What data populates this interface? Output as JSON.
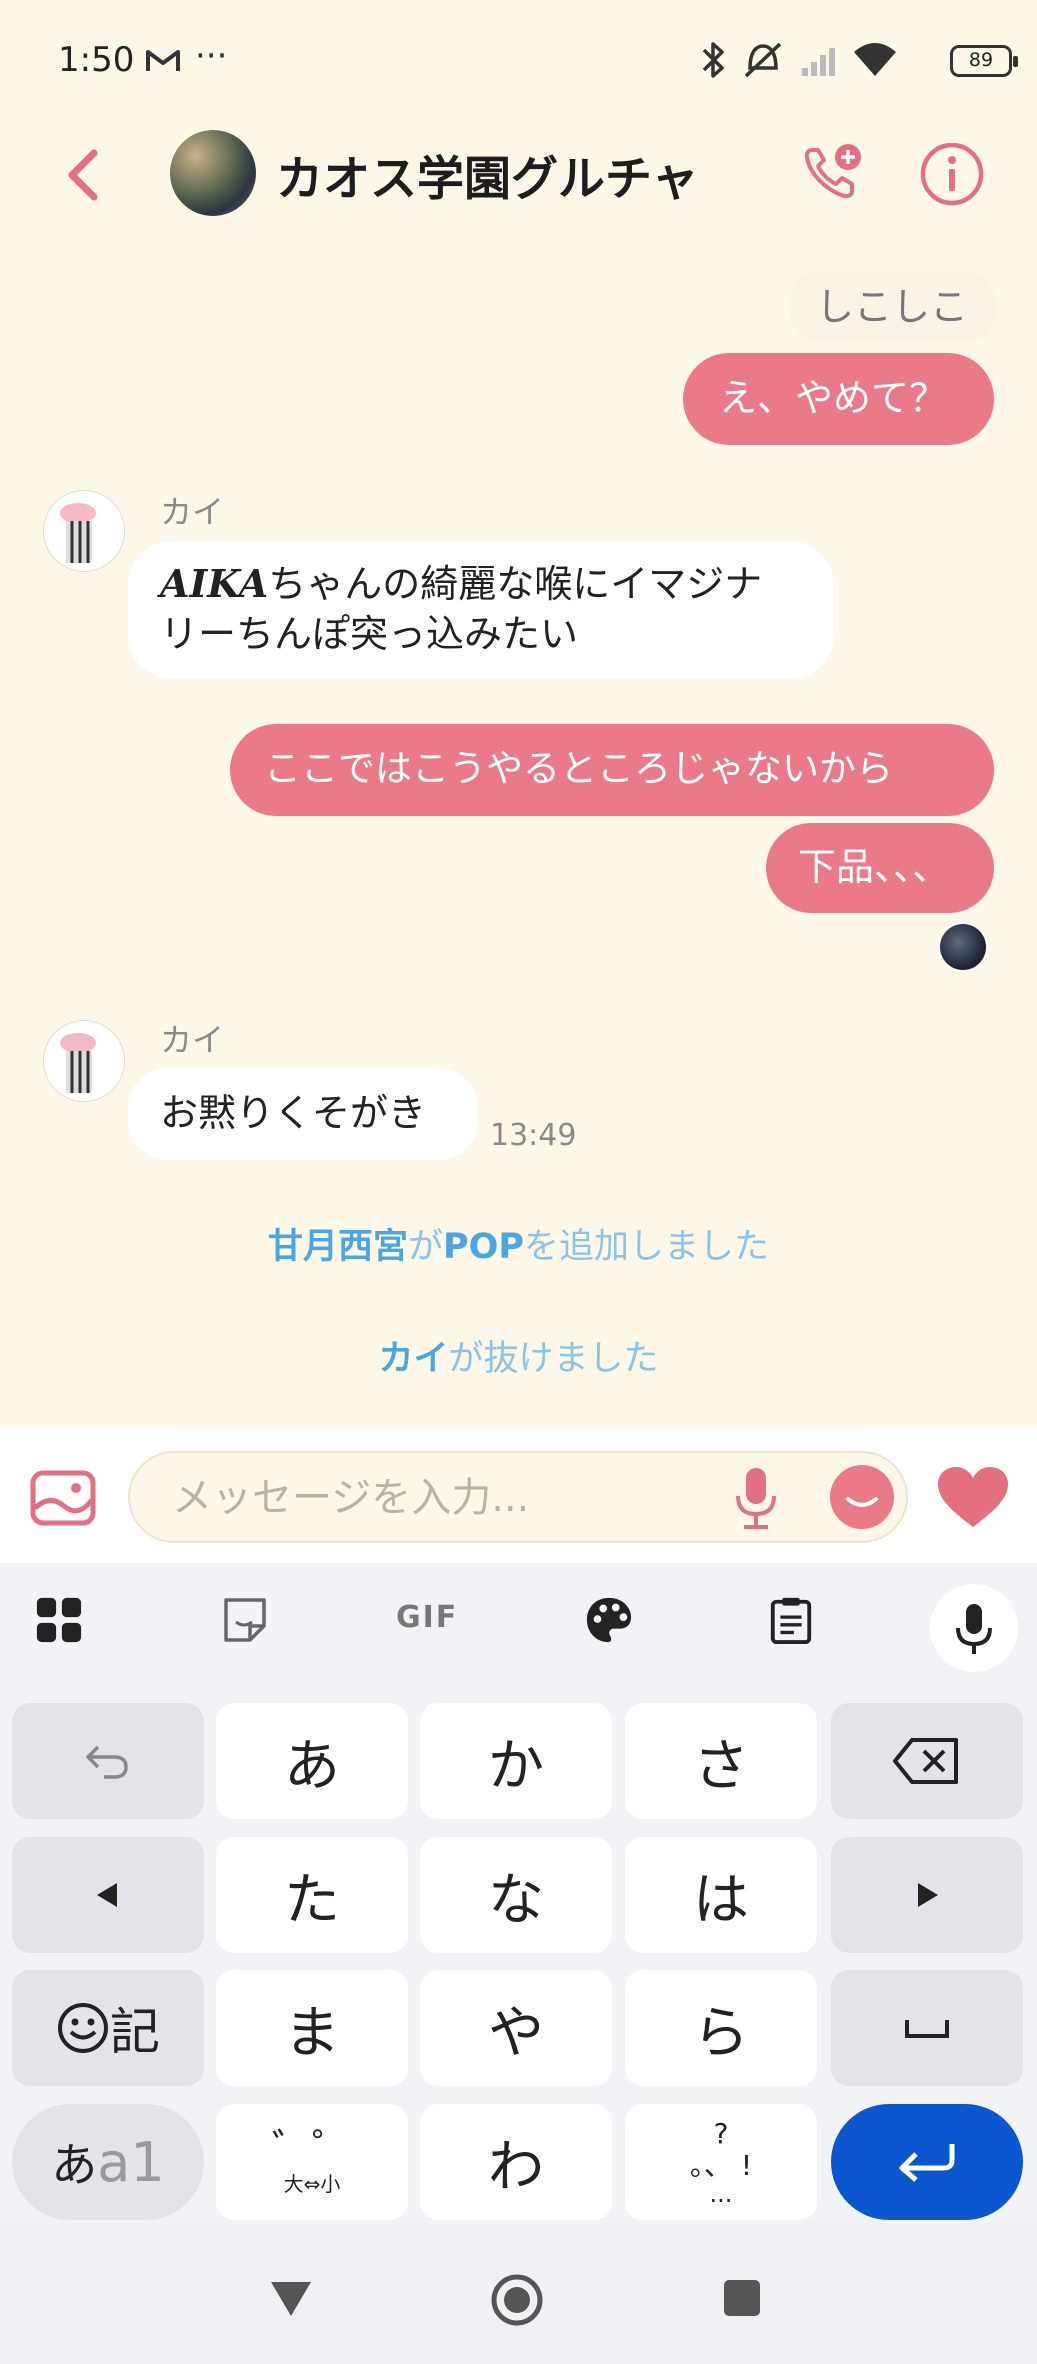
{
  "status_bar": {
    "time": "1:50",
    "overflow": "···",
    "battery": "89"
  },
  "header": {
    "title": "カオス学園グルチャ"
  },
  "messages": {
    "m0_partial": "しこしこ",
    "m1": "え、やめて？",
    "kai1_sender": "カイ",
    "kai1_line1_bold": "AIKA",
    "kai1_line1": "ちゃんの綺麗な喉にイマジナ",
    "kai1_line2": "リーちんぽ突っ込みたい",
    "m2": "ここではこうやるところじゃないから",
    "m3": "下品、、、",
    "kai2_sender": "カイ",
    "kai2_text": "お黙りくそがき",
    "kai2_time": "13:49"
  },
  "system": {
    "s1_actor": "甘月西宮",
    "s1_mid": "が",
    "s1_target": "POP",
    "s1_tail": "を追加しました",
    "s2_actor": "カイ",
    "s2_tail": "が抜けました"
  },
  "input": {
    "placeholder": "メッセージを入力..."
  },
  "keyboard": {
    "toolbar_gif": "GIF",
    "keys": {
      "a": "あ",
      "ka": "か",
      "sa": "さ",
      "ta": "た",
      "na": "な",
      "ha": "は",
      "ma": "ま",
      "ya": "や",
      "ra": "ら",
      "wa": "わ",
      "emoji_label": "記",
      "mode_a": "あ",
      "mode_b": "a1",
      "dakuten_top": "゛゜",
      "dakuten_bottom": "大⇔小",
      "punct_top": "?",
      "punct_mid": "。、 !",
      "punct_bottom": "..."
    }
  },
  "colors": {
    "accent": "#ea7a88",
    "system_text": "#8ac4e8",
    "background": "#fdf7e8",
    "enter_key": "#0b57d0"
  }
}
